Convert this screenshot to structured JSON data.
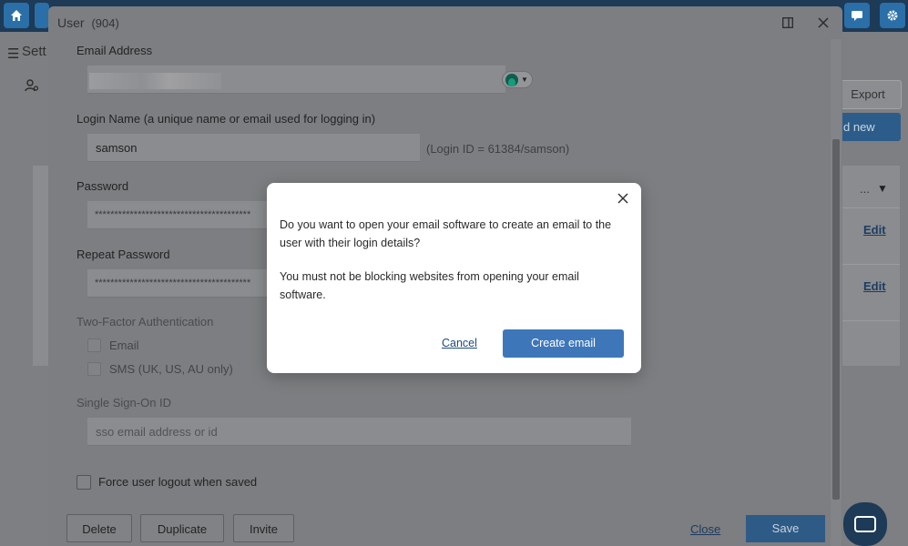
{
  "background": {
    "settings_label": "Sett",
    "export_label": "Export",
    "add_new_label": "d new",
    "dots_label": "...",
    "edit_label_1": "Edit",
    "edit_label_2": "Edit"
  },
  "modal": {
    "title": "User",
    "title_count": "(904)",
    "email_label": "Email Address",
    "login_label": "Login Name (a unique name or email used for logging in)",
    "login_value": "samson",
    "login_hint": "(Login ID = 61384/samson)",
    "password_label": "Password",
    "password_value": "****************************************",
    "repeat_password_label": "Repeat Password",
    "repeat_password_value": "****************************************",
    "twofa_label": "Two-Factor Authentication",
    "twofa_email": "Email",
    "twofa_sms": "SMS (UK, US, AU only)",
    "sso_label": "Single Sign-On ID",
    "sso_placeholder": "sso email address or id",
    "force_logout_label": "Force user logout when saved",
    "delete_label": "Delete",
    "duplicate_label": "Duplicate",
    "invite_label": "Invite",
    "close_label": "Close",
    "save_label": "Save"
  },
  "dialog": {
    "line1": "Do you want to open your email software to create an email to the user with their login details?",
    "line2": "You must not be blocking websites from opening your email software.",
    "cancel_label": "Cancel",
    "create_label": "Create email"
  },
  "colors": {
    "primary": "#3e77b9",
    "topbar": "#1d3a57"
  }
}
